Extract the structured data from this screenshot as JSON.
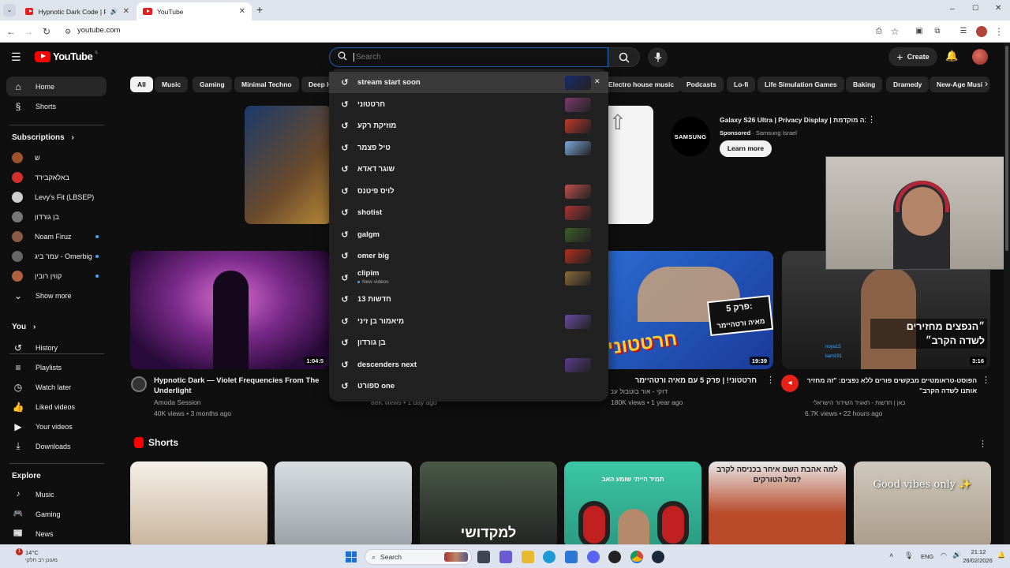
{
  "browser": {
    "tabs": [
      {
        "label": "Hypnotic Dark Code | Futur",
        "active": false
      },
      {
        "label": "YouTube",
        "active": true
      }
    ],
    "new_tab": "+",
    "url": "youtube.com",
    "win_min": "–",
    "win_max": "☐",
    "win_close": "✕"
  },
  "header": {
    "logo_text": "YouTube",
    "logo_region": "IL",
    "search_placeholder": "Search",
    "create_label": "Create"
  },
  "sidebar": {
    "main": [
      {
        "label": "Home",
        "icon": "home-icon"
      },
      {
        "label": "Shorts",
        "icon": "shorts-icon"
      }
    ],
    "subscriptions_title": "Subscriptions",
    "subscriptions": [
      {
        "label": "ש",
        "color": "#a0522d"
      },
      {
        "label": "באלאקבירד",
        "color": "#d32f2f"
      },
      {
        "label": "Levy's Fit (LBSEP)",
        "color": "#cfcfcf"
      },
      {
        "label": "בן גורדון",
        "color": "#777"
      },
      {
        "label": "Noam Firuz",
        "color": "#8a5a44"
      },
      {
        "label": "עמר ביג - Omerbig",
        "color": "#666"
      },
      {
        "label": "קווין רובין",
        "color": "#b06040"
      }
    ],
    "show_more": "Show more",
    "you_title": "You",
    "you": [
      {
        "label": "History",
        "icon": "history-icon"
      },
      {
        "label": "Playlists",
        "icon": "playlists-icon"
      },
      {
        "label": "Watch later",
        "icon": "watch-later-icon"
      },
      {
        "label": "Liked videos",
        "icon": "liked-icon"
      },
      {
        "label": "Your videos",
        "icon": "your-videos-icon"
      },
      {
        "label": "Downloads",
        "icon": "downloads-icon"
      }
    ],
    "explore_title": "Explore",
    "explore": [
      {
        "label": "Music",
        "icon": "music-icon"
      },
      {
        "label": "Gaming",
        "icon": "gaming-icon"
      },
      {
        "label": "News",
        "icon": "news-icon"
      }
    ]
  },
  "chips": [
    "All",
    "Music",
    "Gaming",
    "Minimal Techno",
    "Deep H",
    "Electro house music",
    "Podcasts",
    "Lo-fi",
    "Life Simulation Games",
    "Baking",
    "Dramedy",
    "New-Age Musi"
  ],
  "suggestions": [
    {
      "text": "stream start soon",
      "thumb": "#1b2a6b",
      "remove": "✕"
    },
    {
      "text": "חרטטוני",
      "thumb": "#7a3b6b"
    },
    {
      "text": "מוזיקת רקע",
      "thumb": "#c0392b"
    },
    {
      "text": "טיל פצמר",
      "thumb": "#7da7d9"
    },
    {
      "text": "שוגר דאדא",
      "thumb": ""
    },
    {
      "text": "לויס פיטנס",
      "thumb": "#c0504d"
    },
    {
      "text": "shotist",
      "thumb": "#a33"
    },
    {
      "text": "galgm",
      "thumb": "#3d5a2a"
    },
    {
      "text": "omer big",
      "thumb": "#b03020"
    },
    {
      "text": "clipim",
      "sub": "New videos",
      "thumb": "#8a6a3a"
    },
    {
      "text": "חדשות 13",
      "thumb": ""
    },
    {
      "text": "מיאמור בן זיני",
      "thumb": "#6a4aa0"
    },
    {
      "text": "בן גורדון",
      "thumb": ""
    },
    {
      "text": "descenders next",
      "thumb": "#5a3a8a"
    },
    {
      "text": "ספורט one",
      "thumb": ""
    }
  ],
  "ad": {
    "brand": "SAMSUNG",
    "title": "Galaxy S26 Ultra | Privacy Display | בה מוקדמת",
    "sponsored": "Sponsored",
    "advertiser": "Samsung Israel",
    "cta": "Learn more"
  },
  "videos": [
    {
      "title": "Hypnotic Dark — Violet Frequencies From The Underlight",
      "channel": "Amoda Session",
      "meta": "40K views • 3 months ago",
      "duration": "1:04:5"
    },
    {
      "title": "",
      "channel": "",
      "meta": "88K views • 1 day ago",
      "duration": ""
    },
    {
      "title": "חרטטוני! | פרק 5 עם מאיה ורטהיימר",
      "channel": "דוקי - אור בוטבול עם",
      "meta": "180K views • 1 year ago",
      "duration": "19:39"
    },
    {
      "title": "הפוסט-טראומטיים מבקשים פורים ללא נפצים: \"זה מחזיר אותנו לשדה הקרב\"",
      "channel": "כאן | חדשות - תאגיד השידור הישראלי",
      "meta": "6.7K views • 22 hours ago",
      "duration": "3:16"
    }
  ],
  "thumb_text": {
    "v3_line1": "פרק 5:",
    "v3_line2": "מאיה ורטהיימר",
    "v3_big": "חרטטוני",
    "v4_line1": "״הנפצים מחזירים",
    "v4_line2": "לשדה הקרב״",
    "v4_tag1": "noya15",
    "v4_tag2": "liam191"
  },
  "shorts_title": "Shorts",
  "shorts_text": [
    "",
    "",
    "למקדושי",
    "תמיד הייתי שומע האב",
    "למה אהבת השם איחר בכניסה לקרב מול הטורקים?",
    "Good vibes only ✨"
  ],
  "taskbar": {
    "weather_temp": "14°C",
    "weather_desc": "מעונן רב חלקי",
    "search": "Search",
    "lang": "ENG",
    "time": "21:12",
    "date": "26/02/2026",
    "notif_count": "1"
  }
}
